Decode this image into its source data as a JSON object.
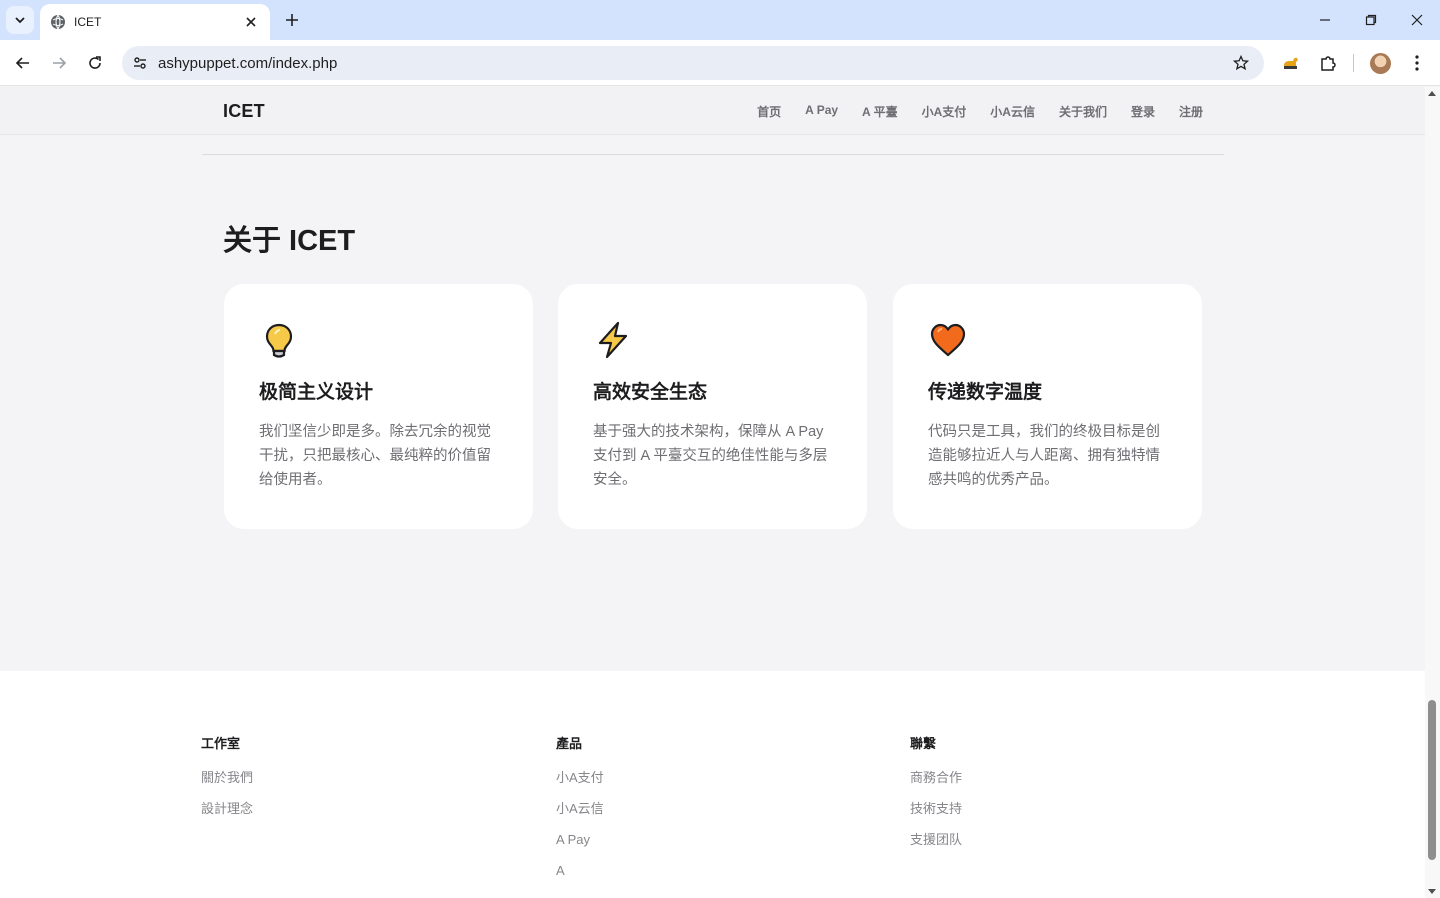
{
  "browser": {
    "tab_title": "ICET",
    "url": "ashypuppet.com/index.php"
  },
  "site": {
    "logo": "ICET",
    "nav": [
      "首页",
      "A Pay",
      "A 平臺",
      "小A支付",
      "小A云信",
      "关于我们",
      "登录",
      "注册"
    ]
  },
  "about": {
    "title": "关于 ICET",
    "cards": [
      {
        "icon": "lightbulb-icon",
        "title": "极简主义设计",
        "text": "我们坚信少即是多。除去冗余的视觉干扰，只把最核心、最纯粹的价值留给使用者。"
      },
      {
        "icon": "lightning-icon",
        "title": "高效安全生态",
        "text": "基于强大的技术架构，保障从 A Pay 支付到 A 平臺交互的绝佳性能与多层安全。"
      },
      {
        "icon": "heart-icon",
        "title": "传递数字温度",
        "text": "代码只是工具，我们的终极目标是创造能够拉近人与人距离、拥有独特情感共鸣的优秀产品。"
      }
    ]
  },
  "footer": {
    "columns": [
      {
        "title": "工作室",
        "links": [
          "關於我們",
          "設計理念"
        ]
      },
      {
        "title": "產品",
        "links": [
          "小A支付",
          "小A云信",
          "A Pay",
          "A"
        ]
      },
      {
        "title": "聯繫",
        "links": [
          "商務合作",
          "技術支持",
          "支援团队"
        ]
      }
    ]
  },
  "colors": {
    "accent_bulb": "#f7c948",
    "accent_bolt": "#f7c948",
    "accent_heart": "#f26b1d",
    "page_bg": "#f4f4f6"
  }
}
